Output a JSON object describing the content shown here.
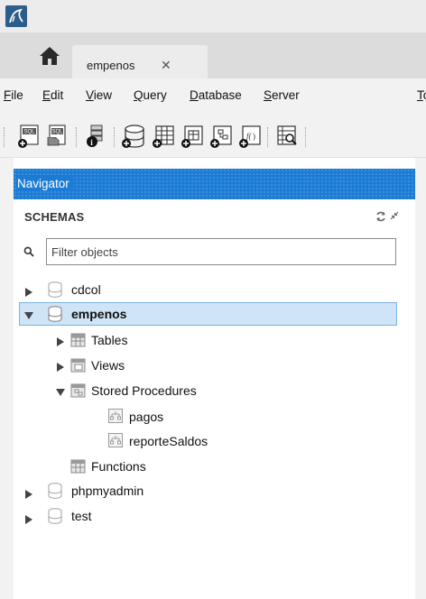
{
  "tabs": {
    "active_tab_label": "empenos",
    "close_glyph": "✕"
  },
  "menu": [
    {
      "label": "File",
      "underline": "F",
      "rest": "ile"
    },
    {
      "label": "Edit",
      "underline": "E",
      "rest": "dit"
    },
    {
      "label": "View",
      "underline": "V",
      "rest": "iew"
    },
    {
      "label": "Query",
      "underline": "Q",
      "rest": "uery"
    },
    {
      "label": "Database",
      "underline": "D",
      "rest": "atabase"
    },
    {
      "label": "Server",
      "underline": "S",
      "rest": "erver"
    },
    {
      "label": "Tools",
      "underline": "T",
      "rest": "o"
    }
  ],
  "navigator": {
    "title": "Navigator",
    "section_label": "SCHEMAS",
    "filter_placeholder": "Filter objects"
  },
  "tree": {
    "cdcol": "cdcol",
    "empenos": "empenos",
    "tables": "Tables",
    "views": "Views",
    "stored_procedures": "Stored Procedures",
    "proc_pagos": "pagos",
    "proc_reporte": "reporteSaldos",
    "functions": "Functions",
    "phpmyadmin": "phpmyadmin",
    "test": "test"
  },
  "colors": {
    "navigator_header": "#1c7cd4",
    "selection_bg": "#cfe4f7",
    "selection_border": "#7ab4e6"
  },
  "icons": {
    "toolbar": [
      "new-sql-tab-icon",
      "open-sql-script-icon",
      "inspector-icon",
      "create-schema-icon",
      "create-table-icon",
      "create-view-icon",
      "create-procedure-icon",
      "create-function-icon",
      "search-table-data-icon"
    ]
  }
}
